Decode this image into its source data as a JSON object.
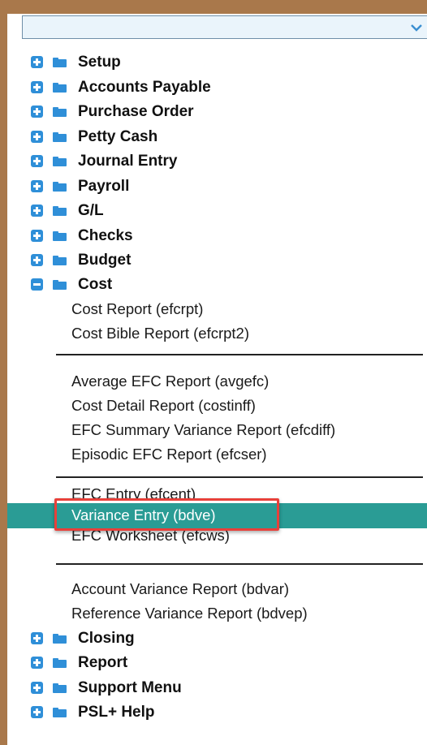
{
  "dropdown": {
    "value": "",
    "icon": "chevron-down-icon"
  },
  "folders_top": [
    {
      "label": "Setup",
      "state": "collapsed"
    },
    {
      "label": "Accounts Payable",
      "state": "collapsed"
    },
    {
      "label": "Purchase Order",
      "state": "collapsed"
    },
    {
      "label": "Petty Cash",
      "state": "collapsed"
    },
    {
      "label": "Journal Entry",
      "state": "collapsed"
    },
    {
      "label": "Payroll",
      "state": "collapsed"
    },
    {
      "label": "G/L",
      "state": "collapsed"
    },
    {
      "label": "Checks",
      "state": "collapsed"
    },
    {
      "label": "Budget",
      "state": "collapsed"
    },
    {
      "label": "Cost",
      "state": "expanded"
    }
  ],
  "cost_items": {
    "group1": [
      "Cost Report (efcrpt)",
      "Cost Bible Report (efcrpt2)"
    ],
    "group2": [
      "Average EFC Report (avgefc)",
      "Cost Detail Report (costinff)",
      "EFC Summary Variance Report (efcdiff)",
      "Episodic EFC Report (efcser)"
    ],
    "group3": [
      "EFC Entry (efcent)",
      "Variance Entry (bdve)",
      "EFC Worksheet (efcws)"
    ],
    "group4": [
      "Account Variance Report (bdvar)",
      "Reference Variance Report (bdvep)"
    ]
  },
  "selected_item": "Variance Entry (bdve)",
  "folders_bottom": [
    {
      "label": "Closing",
      "state": "collapsed"
    },
    {
      "label": "Report",
      "state": "collapsed"
    },
    {
      "label": "Support Menu",
      "state": "collapsed"
    },
    {
      "label": "PSL+ Help",
      "state": "collapsed"
    }
  ],
  "colors": {
    "frame": "#a9784b",
    "icon_blue": "#2f8fd8",
    "selection": "#2a9c95",
    "highlight_box": "#e8403a"
  }
}
